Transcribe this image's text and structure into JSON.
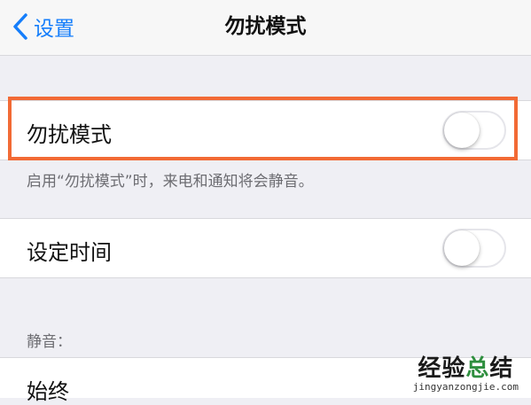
{
  "nav": {
    "back_label": "设置",
    "title": "勿扰模式"
  },
  "dnd": {
    "label": "勿扰模式",
    "switch_on": false,
    "footer": "启用“勿扰模式”时，来电和通知将会静音。"
  },
  "scheduled": {
    "label": "设定时间",
    "switch_on": false
  },
  "silence": {
    "header": "静音：",
    "items": [
      {
        "label": "始终"
      }
    ]
  },
  "watermark": {
    "part1": "经验",
    "part2": "总",
    "part3": "结",
    "url": "jingyanzongjie.com"
  },
  "colors": {
    "accent_blue": "#157efb",
    "highlight_orange": "#f26a35",
    "background": "#efeff4"
  }
}
